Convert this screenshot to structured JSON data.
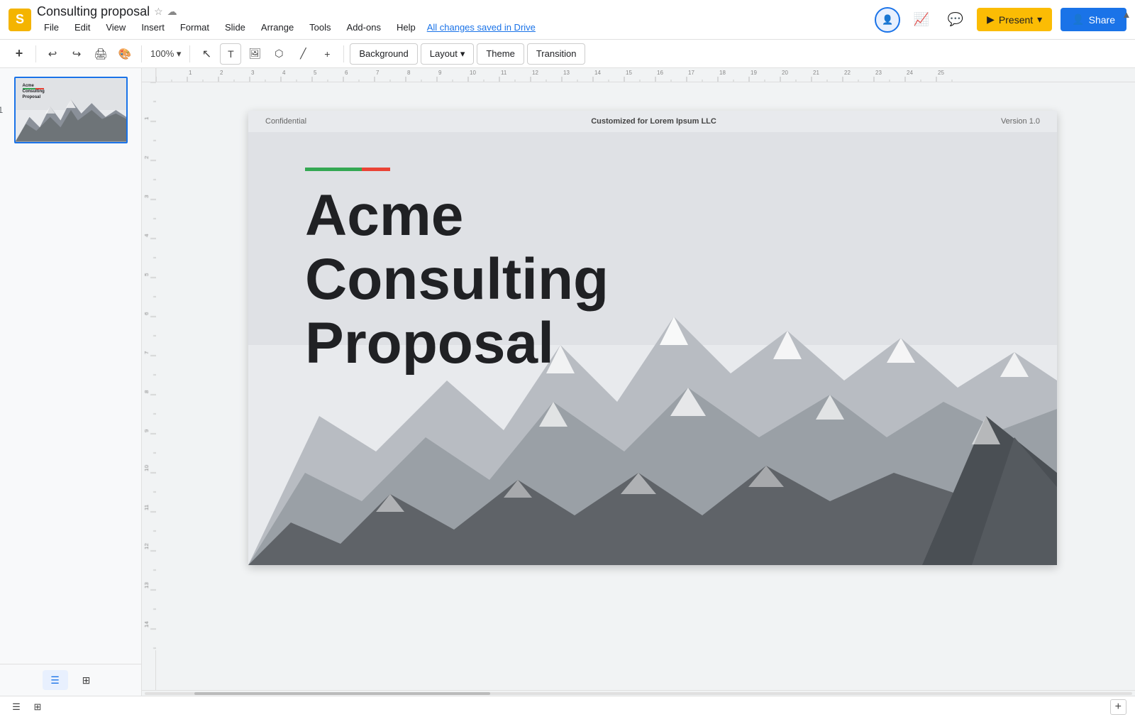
{
  "app": {
    "icon": "S",
    "doc_title": "Consulting proposal",
    "autosave_text": "All changes saved in Drive"
  },
  "menu": {
    "items": [
      "File",
      "Edit",
      "View",
      "Insert",
      "Format",
      "Slide",
      "Arrange",
      "Tools",
      "Add-ons",
      "Help"
    ]
  },
  "toolbar": {
    "background_label": "Background",
    "layout_label": "Layout",
    "theme_label": "Theme",
    "transition_label": "Transition"
  },
  "header_right": {
    "present_label": "Present",
    "share_label": "Share"
  },
  "slide": {
    "number": "1",
    "header_left": "Confidential",
    "header_center_prefix": "Customized for ",
    "header_center_company": "Lorem Ipsum LLC",
    "header_right": "Version 1.0",
    "title_line1": "Acme",
    "title_line2": "Consulting",
    "title_line3": "Proposal"
  },
  "thumbnail": {
    "slide_number": "1",
    "title_text": "Acme\nConsulting\nProposal"
  },
  "bottom_bar": {
    "slide_view_icon": "☰",
    "grid_view_icon": "⊞",
    "zoom_in_icon": "+",
    "zoom_out_icon": "−"
  }
}
